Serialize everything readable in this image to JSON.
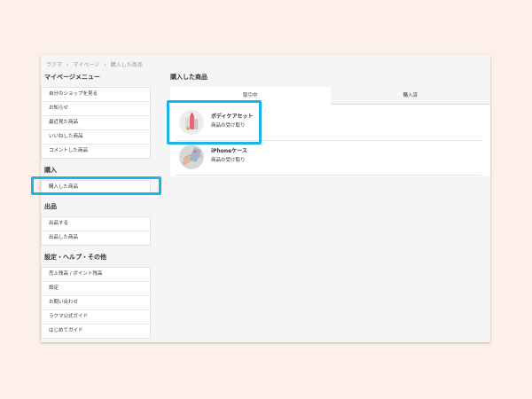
{
  "breadcrumb": [
    "ラクマ",
    "マイページ",
    "購入した商品"
  ],
  "sidebar": {
    "title": "マイページメニュー",
    "group1": [
      "自分のショップを見る",
      "お知らせ",
      "最近見た商品",
      "いいねした商品",
      "コメントした商品"
    ],
    "purchase_heading": "購入",
    "purchase_items": [
      "購入した商品"
    ],
    "sell_heading": "出品",
    "sell_items": [
      "出品する",
      "出品した商品"
    ],
    "settings_heading": "設定・ヘルプ・その他",
    "settings_items": [
      "売上残高 / ポイント残高",
      "設定",
      "お問い合わせ",
      "ラクマ公式ガイド",
      "はじめてガイド"
    ]
  },
  "main": {
    "title": "購入した商品",
    "tabs": [
      "取引中",
      "購入済"
    ],
    "items": [
      {
        "name": "ボディケアセット",
        "status": "商品の受け取り",
        "icon": "body-care-set-thumbnail"
      },
      {
        "name": "iPhoneケース",
        "status": "商品の受け取り",
        "icon": "iphone-case-thumbnail"
      }
    ]
  },
  "colors": {
    "page_bg": "#fdf0e8",
    "highlight": "#1bb4ea",
    "window_bg": "#f5f5f5"
  }
}
